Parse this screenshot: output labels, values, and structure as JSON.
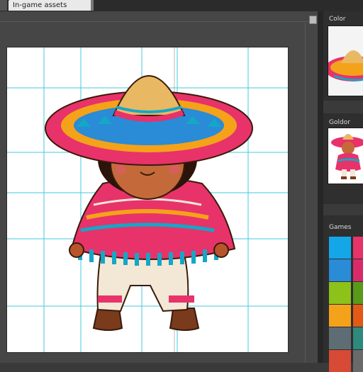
{
  "tabs": {
    "active_title": "In-game assets"
  },
  "panels": {
    "color_title": "Color",
    "preview_title": "Goldor",
    "games_title": "Games"
  },
  "swatches": [
    "#14a7e8",
    "#e8326a",
    "#2a8bd6",
    "#d92b6a",
    "#8cc21a",
    "#5a9a1a",
    "#f4a21a",
    "#e35a14",
    "#5e6d73",
    "#2e8a7c",
    "#d64a36",
    "#6a6a6a"
  ]
}
